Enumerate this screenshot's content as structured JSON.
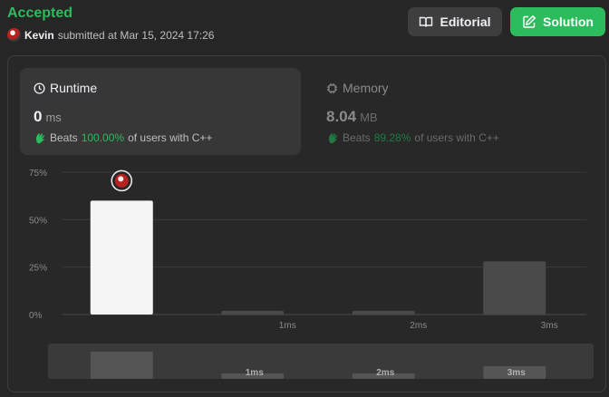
{
  "header": {
    "status": "Accepted",
    "username": "Kevin",
    "submitted_text": "submitted at Mar 15, 2024 17:26"
  },
  "buttons": {
    "editorial": "Editorial",
    "solution": "Solution"
  },
  "runtime": {
    "title": "Runtime",
    "value": "0",
    "unit": "ms",
    "beats_label": "Beats",
    "beats_pct": "100.00%",
    "beats_suffix": "of users with C++"
  },
  "memory": {
    "title": "Memory",
    "value": "8.04",
    "unit": "MB",
    "beats_label": "Beats",
    "beats_pct": "89.28%",
    "beats_suffix": "of users with C++"
  },
  "colors": {
    "accent_green": "#2cbb5d",
    "highlight_bar": "#f5f5f5",
    "bar": "#4a4a4a"
  },
  "chart_data": {
    "type": "bar",
    "categories": [
      "",
      "1ms",
      "2ms",
      "3ms"
    ],
    "values": [
      60,
      2,
      2,
      28
    ],
    "highlight_index": 0,
    "yticks": [
      "75%",
      "50%",
      "25%",
      "0%"
    ],
    "ylim": [
      0,
      75
    ],
    "grid": true,
    "minimap_labels": [
      "",
      "1ms",
      "2ms",
      "3ms"
    ]
  }
}
